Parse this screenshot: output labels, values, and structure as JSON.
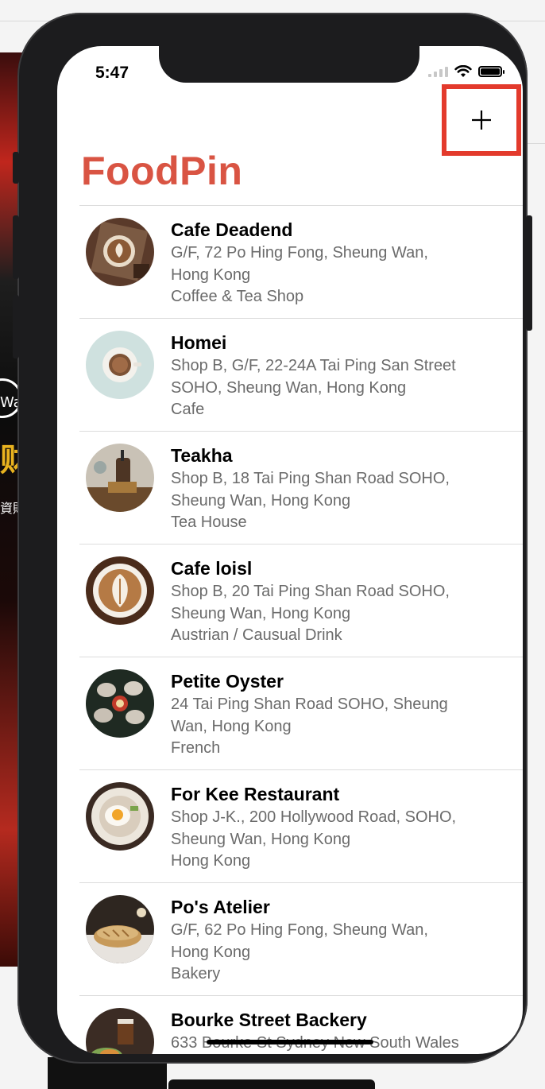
{
  "background": {
    "left_snippets": [
      "Watc",
      "财",
      "資財"
    ]
  },
  "status_bar": {
    "time": "5:47"
  },
  "nav": {
    "title": "FoodPin",
    "add_button_label": "+"
  },
  "restaurants": [
    {
      "name": "Cafe Deadend",
      "address_line1": "G/F, 72 Po Hing Fong, Sheung Wan,",
      "address_line2": "Hong Kong",
      "type": "Coffee & Tea Shop",
      "thumb_icon": "latte-art-photo"
    },
    {
      "name": "Homei",
      "address_line1": "Shop B, G/F, 22-24A Tai Ping San Street",
      "address_line2": "SOHO, Sheung Wan, Hong Kong",
      "type": "Cafe",
      "thumb_icon": "coffee-cup-photo"
    },
    {
      "name": "Teakha",
      "address_line1": "Shop B, 18 Tai Ping Shan Road SOHO,",
      "address_line2": "Sheung Wan, Hong Kong",
      "type": "Tea House",
      "thumb_icon": "teapot-photo"
    },
    {
      "name": "Cafe loisl",
      "address_line1": "Shop B, 20 Tai Ping Shan Road SOHO,",
      "address_line2": "Sheung Wan, Hong Kong",
      "type": "Austrian / Causual Drink",
      "thumb_icon": "cappuccino-photo"
    },
    {
      "name": "Petite Oyster",
      "address_line1": "24 Tai Ping Shan Road SOHO, Sheung",
      "address_line2": "Wan, Hong Kong",
      "type": "French",
      "thumb_icon": "oysters-photo"
    },
    {
      "name": "For Kee Restaurant",
      "address_line1": "Shop J-K., 200 Hollywood Road, SOHO,",
      "address_line2": "Sheung Wan, Hong Kong",
      "type": "Hong Kong",
      "thumb_icon": "egg-dish-photo"
    },
    {
      "name": "Po's Atelier",
      "address_line1": "G/F, 62 Po Hing Fong, Sheung Wan,",
      "address_line2": "Hong Kong",
      "type": "Bakery",
      "thumb_icon": "bread-photo"
    },
    {
      "name": "Bourke Street Backery",
      "address_line1": "633 Bourke St Sydney New South Wales",
      "address_line2": "",
      "type": "",
      "thumb_icon": "drink-photo"
    }
  ],
  "colors": {
    "title": "#d95443",
    "highlight_box": "#e33a2c",
    "secondary_text": "#6b6b6b"
  }
}
